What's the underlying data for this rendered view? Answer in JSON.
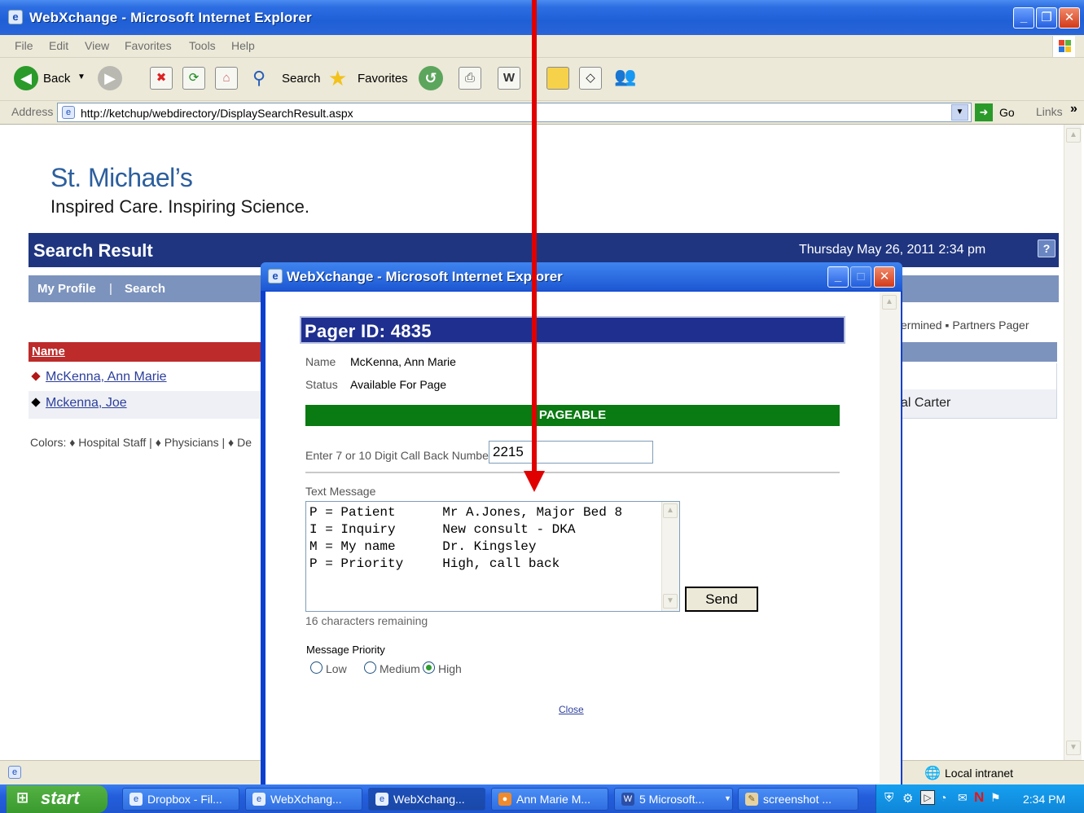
{
  "window": {
    "title": "WebXchange - Microsoft Internet Explorer",
    "menu": [
      "File",
      "Edit",
      "View",
      "Favorites",
      "Tools",
      "Help"
    ]
  },
  "toolbar": {
    "back_label": "Back",
    "search_label": "Search",
    "favorites_label": "Favorites"
  },
  "address": {
    "label": "Address",
    "url": "http://ketchup/webdirectory/DisplaySearchResult.aspx",
    "go_label": "Go",
    "links_label": "Links"
  },
  "page": {
    "logo_main": "St. Michael’s",
    "logo_sub": "Inspired Care. Inspiring Science.",
    "header_title": "Search Result",
    "header_date": "Thursday May 26, 2011 2:34 pm",
    "help_label": "?",
    "nav": [
      "My Profile",
      "|",
      "Search"
    ],
    "name_header": "Name",
    "results": [
      "McKenna, Ann Marie",
      "Mckenna, Joe"
    ],
    "colors_legend": "Colors: ♦ Hospital Staff | ♦ Physicians | ♦ De",
    "legend_right": "ermined  ▪ Partners Pager",
    "right_col_value": "al Carter"
  },
  "popup": {
    "title": "WebXchange - Microsoft Internet Explorer",
    "pager_header": "Pager ID:   4835",
    "name_label": "Name",
    "name_value": "McKenna, Ann Marie",
    "status_label": "Status",
    "status_value": "Available For Page",
    "pageable_label": "PAGEABLE",
    "callback_label": "Enter 7 or 10 Digit Call Back Number",
    "callback_value": "2215",
    "text_message_label": "Text Message",
    "message_lines": [
      "P = Patient      Mr A.Jones, Major Bed 8",
      "I = Inquiry      New consult - DKA",
      "M = My name      Dr. Kingsley",
      "P = Priority     High, call back"
    ],
    "chars_remaining": "16 characters remaining",
    "send_label": "Send",
    "priority_label": "Message Priority",
    "priority_options": [
      "Low",
      "Medium",
      "High"
    ],
    "priority_selected": "High",
    "close_label": "Close"
  },
  "statusbar": {
    "zone": "Local intranet"
  },
  "taskbar": {
    "start_label": "start",
    "items": [
      "Dropbox - Fil...",
      "WebXchang...",
      "WebXchang...",
      "Ann Marie M...",
      "5 Microsoft...",
      "screenshot ..."
    ],
    "time": "2:34 PM"
  },
  "colors": {
    "accent_navy": "#1f3580",
    "pageable_green": "#0a7a12",
    "name_header_red": "#bd2b2b",
    "arrow_red": "#e10000"
  }
}
